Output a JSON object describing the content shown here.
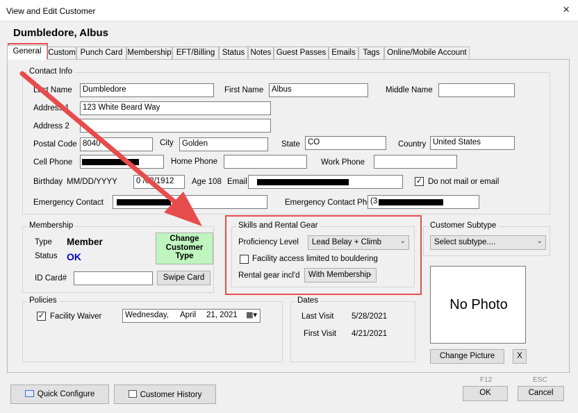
{
  "window": {
    "title": "View and Edit Customer",
    "close_glyph": "×"
  },
  "customer_name": "Dumbledore, Albus",
  "tabs": [
    "General",
    "Custom",
    "Punch Card",
    "Membership",
    "EFT/Billing",
    "Status",
    "Notes",
    "Guest Passes",
    "Emails",
    "Tags",
    "Online/Mobile Account"
  ],
  "contact": {
    "legend": "Contact Info",
    "last_name_label": "Last Name",
    "last_name": "Dumbledore",
    "first_name_label": "First Name",
    "first_name": "Albus",
    "middle_name_label": "Middle Name",
    "middle_name": "",
    "address1_label": "Address 1",
    "address1": "123 White Beard Way",
    "address2_label": "Address 2",
    "address2": "",
    "postal_label": "Postal Code",
    "postal": "8040",
    "city_label": "City",
    "city": "Golden",
    "state_label": "State",
    "state": "CO",
    "country_label": "Country",
    "country": "United States",
    "cell_label": "Cell Phone",
    "home_label": "Home Phone",
    "home": "",
    "work_label": "Work Phone",
    "work": "",
    "birthday_label": "Birthday",
    "birthday_format": "MM/DD/YYYY",
    "birthday": "0 /02/1912",
    "age_label": "Age 108",
    "email_label": "Email",
    "dnm_label": "Do not mail or email",
    "dnm_checked": "✓",
    "emergency_label": "Emergency Contact",
    "emergency_phone_label": "Emergency Contact Phone",
    "emergency_phone": "(3"
  },
  "membership": {
    "legend": "Membership",
    "type_label": "Type",
    "type": "Member",
    "status_label": "Status",
    "status": "OK",
    "change_type_button": "Change Customer Type",
    "idcard_label": "ID Card#",
    "idcard": "",
    "swipe_button": "Swipe Card"
  },
  "skills": {
    "legend": "Skills and Rental Gear",
    "proficiency_label": "Proficiency Level",
    "proficiency": "Lead Belay + Climb",
    "facility_label": "Facility access limited to bouldering",
    "rental_label": "Rental gear incl'd",
    "rental": "With Membership"
  },
  "subtype": {
    "legend": "Customer Subtype",
    "value": "Select subtype...."
  },
  "photo": {
    "text": "No Photo",
    "change_button": "Change Picture",
    "clear_button": "X"
  },
  "policies": {
    "legend": "Policies",
    "waiver_label": "Facility Waiver",
    "waiver_checked": "✓",
    "date_day": "Wednesday,",
    "date_month": "April",
    "date_rest": "21, 2021"
  },
  "dates": {
    "legend": "Dates",
    "last_visit_label": "Last Visit",
    "last_visit": "5/28/2021",
    "first_visit_label": "First Visit",
    "first_visit": "4/21/2021"
  },
  "footer": {
    "quick_configure": "Quick Configure",
    "customer_history": "Customer History",
    "ok_hint": "F12",
    "ok": "OK",
    "cancel_hint": "ESC",
    "cancel": "Cancel"
  },
  "colors": {
    "annotation_red": "#e74c4c",
    "status_blue": "#0000cc",
    "change_type_green": "#c0f5c0"
  }
}
